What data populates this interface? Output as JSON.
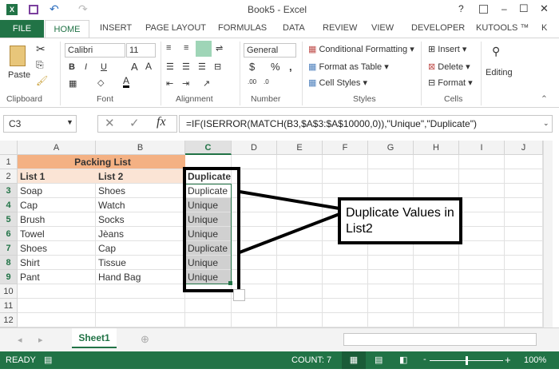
{
  "window": {
    "title": "Book5 - Excel",
    "help": "?",
    "minimize": "–",
    "maximize": "☐",
    "close": "✕"
  },
  "ribbon_tabs": [
    "FILE",
    "HOME",
    "INSERT",
    "PAGE LAYOUT",
    "FORMULAS",
    "DATA",
    "REVIEW",
    "VIEW",
    "DEVELOPER",
    "KUTOOLS ™",
    "K"
  ],
  "ribbon": {
    "paste": "Paste",
    "font_name": "Calibri",
    "font_size": "11",
    "bold": "B",
    "italic": "I",
    "underline": "U",
    "number_format": "General",
    "currency": "$",
    "percent": "%",
    "comma": ",",
    "conditional_formatting": "Conditional Formatting",
    "format_as_table": "Format as Table",
    "cell_styles": "Cell Styles",
    "insert": "Insert",
    "delete": "Delete",
    "format": "Format",
    "editing": "Editing",
    "groups": [
      "Clipboard",
      "Font",
      "Alignment",
      "Number",
      "Styles",
      "Cells"
    ]
  },
  "formula_bar": {
    "name_box": "C3",
    "cancel": "✕",
    "enter": "✓",
    "fx": "fx",
    "formula": "=IF(ISERROR(MATCH(B3,$A$3:$A$10000,0)),\"Unique\",\"Duplicate\")"
  },
  "columns": [
    "A",
    "B",
    "C",
    "D",
    "E",
    "F",
    "G",
    "H",
    "I",
    "J"
  ],
  "rows": [
    "1",
    "2",
    "3",
    "4",
    "5",
    "6",
    "7",
    "8",
    "9",
    "10",
    "11",
    "12"
  ],
  "sheet": {
    "title": "Packing List",
    "headers": [
      "List 1",
      "List 2",
      "Duplicate"
    ],
    "data": [
      [
        "Soap",
        "Shoes",
        "Duplicate"
      ],
      [
        "Cap",
        "Watch",
        "Unique"
      ],
      [
        "Brush",
        "Socks",
        "Unique"
      ],
      [
        "Towel",
        "Jèans",
        "Unique"
      ],
      [
        "Shoes",
        "Cap",
        "Duplicate"
      ],
      [
        "Shirt",
        "Tissue",
        "Unique"
      ],
      [
        "Pant",
        "Hand Bag",
        "Unique"
      ]
    ]
  },
  "callout": "Duplicate Values in List2",
  "sheet_tabs": {
    "active": "Sheet1"
  },
  "status": {
    "ready": "READY",
    "count": "COUNT: 7",
    "zoom": "100%",
    "minus": "-",
    "plus": "+"
  },
  "colors": {
    "excel_green": "#217346",
    "title_fill": "#f4b183",
    "header_fill": "#fbe4d5",
    "selection": "#d0d0d0"
  }
}
